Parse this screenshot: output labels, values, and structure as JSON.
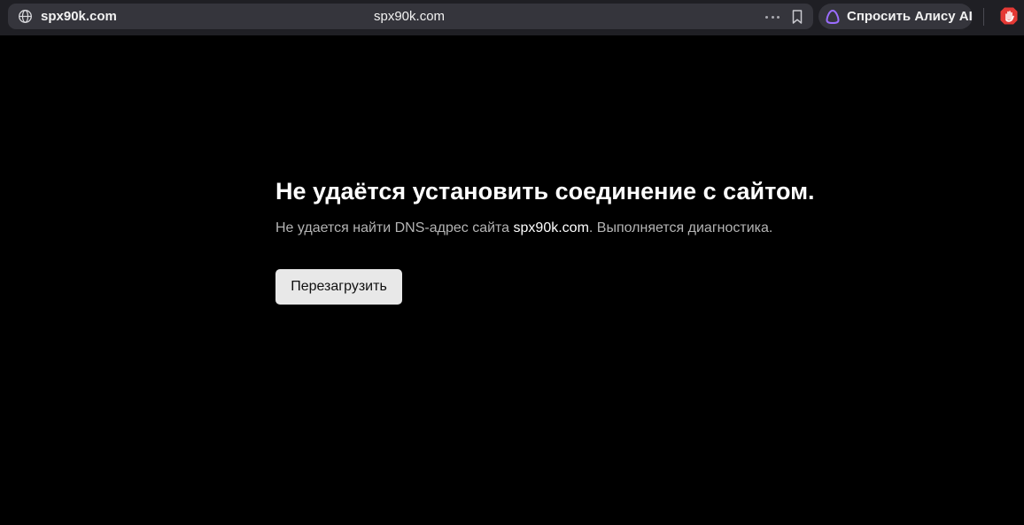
{
  "browser": {
    "omnibox": {
      "host": "spx90k.com",
      "page_title": "spx90k.com",
      "site_icon": "globe-icon",
      "more_icon": "more-horizontal-icon",
      "bookmark_icon": "bookmark-icon"
    },
    "alice": {
      "label": "Спросить Алису AI",
      "icon": "alice-icon",
      "accent_color": "#8b5cf6"
    },
    "extension": {
      "icon": "adblock-hand-icon",
      "color": "#e53935"
    }
  },
  "error_page": {
    "title": "Не удаётся установить соединение с сайтом.",
    "description_prefix": "Не удается найти DNS-адрес сайта ",
    "description_host": "spx90k.com",
    "description_suffix": ". Выполняется диагностика.",
    "reload_label": "Перезагрузить",
    "background_color": "#000000"
  }
}
